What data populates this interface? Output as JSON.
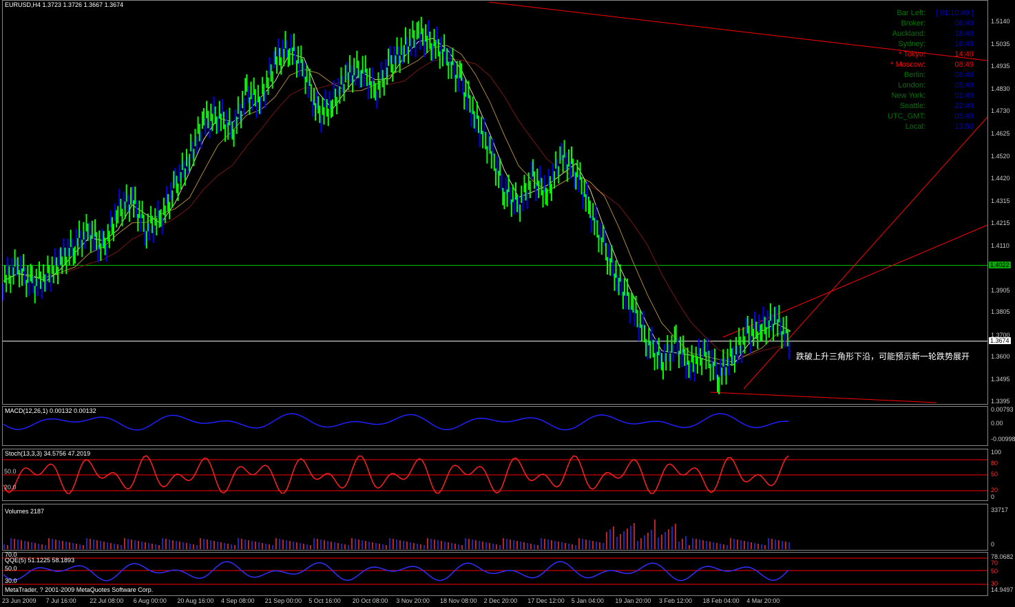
{
  "main": {
    "title": "EURUSD,H4  1.3723 1.3726 1.3667 1.3674",
    "annotation": "跌破上升三角形下沿，可能预示新一轮跌势展开",
    "y_ticks": [
      "1.5140",
      "1.5035",
      "1.4935",
      "1.4830",
      "1.4730",
      "1.4625",
      "1.4520",
      "1.4420",
      "1.4315",
      "1.4215",
      "1.4110",
      "1.4022",
      "1.3905",
      "1.3805",
      "1.3700",
      "1.3674",
      "1.3600",
      "1.3495",
      "1.3395"
    ],
    "badge_green": "1.4022",
    "badge_white": "1.3674"
  },
  "clock": {
    "bar_left": {
      "label": "Bar Left:",
      "value": "[ 01:10:49 ]"
    },
    "rows": [
      {
        "label": "Broker:",
        "value": "06:49",
        "highlight": false
      },
      {
        "label": "Auckland:",
        "value": "18:49",
        "highlight": false
      },
      {
        "label": "Sydney:",
        "value": "16:49",
        "highlight": false
      },
      {
        "label": "* Tokyo:",
        "value": "14:49",
        "highlight": true
      },
      {
        "label": "* Moscow:",
        "value": "08:49",
        "highlight": true
      },
      {
        "label": "Berlin:",
        "value": "06:49",
        "highlight": false
      },
      {
        "label": "London:",
        "value": "05:49",
        "highlight": false
      },
      {
        "label": "New York:",
        "value": "01:49",
        "highlight": false
      },
      {
        "label": "Seattle:",
        "value": "22:49",
        "highlight": false
      },
      {
        "label": "UTC_GMT:",
        "value": "05:49",
        "highlight": false
      },
      {
        "label": "Local:",
        "value": "13:50",
        "highlight": false
      }
    ]
  },
  "macd": {
    "title": "MACD(12,26,1) 0.00132 0.00132",
    "ticks": [
      "0.00793",
      "0.00",
      "-0.00998"
    ]
  },
  "stoch": {
    "title": "Stoch(13,3,3) 34.5756 47.2019",
    "left_ticks": [
      "50.0",
      "20.0"
    ],
    "right_ticks": [
      "100",
      "80",
      "50",
      "20",
      "0"
    ]
  },
  "volumes": {
    "title": "Volumes 2187",
    "ticks": [
      "33717",
      "0"
    ]
  },
  "qqe": {
    "title": "QQE(5) 51.1225 58.1893",
    "left_ticks": [
      "70.0",
      "50.0",
      "30.0"
    ],
    "right_ticks": [
      "78.0682",
      "70",
      "50",
      "30",
      "14.9497"
    ],
    "footer": "MetaTrader, ? 2001-2009 MetaQuotes Software Corp."
  },
  "x_ticks": [
    "23 Jun 2009",
    "7 Jul 16:00",
    "22 Jul 08:00",
    "6 Aug 00:00",
    "20 Aug 16:00",
    "4 Sep 08:00",
    "21 Sep 00:00",
    "5 Oct 16:00",
    "20 Oct 08:00",
    "3 Nov 20:00",
    "18 Nov 08:00",
    "2 Dec 20:00",
    "17 Dec 12:00",
    "5 Jan 04:00",
    "19 Jan 20:00",
    "3 Feb 12:00",
    "18 Feb 04:00",
    "4 Mar 20:00"
  ],
  "colors": {
    "bull": "#00ff00",
    "bear": "#0000ff",
    "red": "#ff0000",
    "white": "#ffffff",
    "clock_green": "#007700",
    "clock_red": "#ff0000"
  },
  "chart_data": {
    "type": "line",
    "title": "EURUSD,H4",
    "ylim": [
      1.3395,
      1.514
    ],
    "series": [
      {
        "values": [
          1.395,
          1.402,
          1.393,
          1.397,
          1.404,
          1.412,
          1.418,
          1.409,
          1.428,
          1.432,
          1.419,
          1.424,
          1.438,
          1.452,
          1.468,
          1.472,
          1.464,
          1.481,
          1.478,
          1.496,
          1.503,
          1.492,
          1.471,
          1.477,
          1.489,
          1.493,
          1.482,
          1.494,
          1.502,
          1.508,
          1.505,
          1.498,
          1.486,
          1.47,
          1.455,
          1.437,
          1.43,
          1.442,
          1.436,
          1.452,
          1.446,
          1.428,
          1.41,
          1.395,
          1.382,
          1.368,
          1.358,
          1.366,
          1.356,
          1.362,
          1.352,
          1.361,
          1.37,
          1.374,
          1.377,
          1.367
        ]
      }
    ]
  }
}
